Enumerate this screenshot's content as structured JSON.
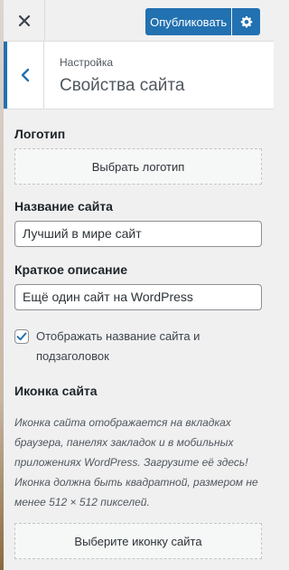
{
  "header": {
    "close_label": "Закрыть",
    "publish_label": "Опубликовать"
  },
  "section": {
    "breadcrumb": "Настройка",
    "title": "Свойства сайта"
  },
  "logo": {
    "label": "Логотип",
    "button_label": "Выбрать логотип"
  },
  "site_title": {
    "label": "Название сайта",
    "value": "Лучший в мире сайт"
  },
  "tagline": {
    "label": "Краткое описание",
    "value": "Ещё один сайт на WordPress"
  },
  "display_header_text": {
    "label": "Отображать название сайта и подзаголовок",
    "checked": true
  },
  "site_icon": {
    "label": "Иконка сайта",
    "description_1": "Иконка сайта отображается на вкладках браузера, панелях закладок и в мобильных приложениях WordPress. Загрузите её здесь!",
    "description_2": "Иконка должна быть квадратной, размером не менее 512 × 512 пикселей.",
    "button_label": "Выберите иконку сайта"
  },
  "colors": {
    "accent": "#2271b1",
    "panel_bg": "#f0f0f1"
  },
  "icons": {
    "close": "close-icon",
    "settings": "gear-icon",
    "back": "chevron-left-icon",
    "check": "checkmark-icon"
  }
}
